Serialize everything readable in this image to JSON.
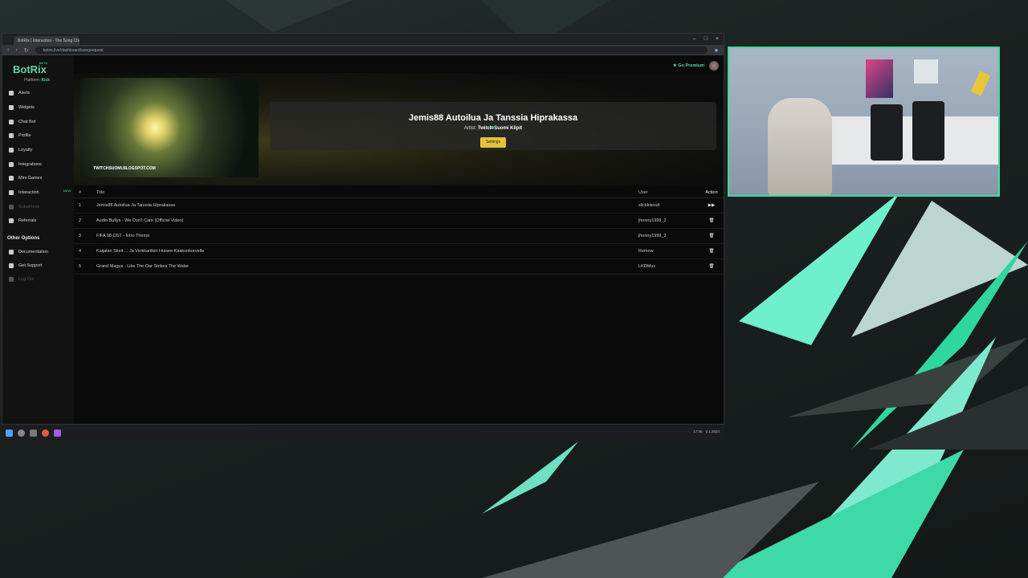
{
  "browser": {
    "tab_title": "BotRix | Interaction - The Song Chart",
    "url": "botrix.live/dashboard/songrequest",
    "window_controls": [
      "–",
      "□",
      "×"
    ]
  },
  "sidebar": {
    "logo": "BotRix",
    "beta": "BETA",
    "platform_label": "Platform:",
    "platform_value": "Kick",
    "items": [
      {
        "label": "Alerts",
        "icon": "bell-icon"
      },
      {
        "label": "Widgets",
        "icon": "widget-icon"
      },
      {
        "label": "Chat Bot",
        "icon": "chat-icon"
      },
      {
        "label": "Profile",
        "icon": "user-icon"
      },
      {
        "label": "Loyalty",
        "icon": "trophy-icon"
      },
      {
        "label": "Integrations",
        "icon": "plug-icon"
      },
      {
        "label": "Mini Games",
        "icon": "gamepad-icon"
      },
      {
        "label": "Interaction",
        "icon": "music-icon"
      },
      {
        "label": "Subathons",
        "icon": "clock-icon"
      },
      {
        "label": "Referrals",
        "icon": "users-icon"
      }
    ],
    "new_badge": "NEW",
    "other_heading": "Other Options",
    "other_items": [
      {
        "label": "Documentation",
        "icon": "book-icon"
      },
      {
        "label": "Get Support",
        "icon": "support-icon"
      },
      {
        "label": "Log Out",
        "icon": "logout-icon"
      }
    ]
  },
  "header": {
    "premium_label": "Go Premium"
  },
  "now_playing": {
    "title": "Jemis88 Autoilua Ja Tanssia Hiprakassa",
    "artist_label": "Artist:",
    "artist": "Twitch Suomi Klipit",
    "settings_label": "Settings",
    "thumbnail_caption": "TWITCHSUOMI.BLOGSPOT.COM"
  },
  "queue": {
    "columns": [
      "#",
      "Title",
      "User",
      "Action"
    ],
    "rows": [
      {
        "num": "1",
        "title": "Jemis88 Autoilua Ja Tanssia Hiprakassa",
        "user": "slickkisoull",
        "action": "▶▶"
      },
      {
        "num": "2",
        "title": "Audio Bullys - We Don't Care (Official Video)",
        "user": "jhonny1999_2",
        "action": "🗑"
      },
      {
        "num": "3",
        "title": "FIFA 98 OST - Intro Theme",
        "user": "jhonny1999_2",
        "action": "🗑"
      },
      {
        "num": "4",
        "title": "Kaijalan Skeit ... Ja Verkkarilkin Huisee Kaakonkorvelle",
        "user": "Remow",
        "action": "🗑"
      },
      {
        "num": "5",
        "title": "Grand Magus - Like The Oar Strikes The Water",
        "user": "LKDMus",
        "action": "🗑"
      }
    ]
  },
  "taskbar": {
    "time": "17:38",
    "date": "2.1.2024"
  },
  "colors": {
    "accent": "#5fd6a3",
    "button": "#e6c23a",
    "cam_border": "#3ddba0"
  }
}
